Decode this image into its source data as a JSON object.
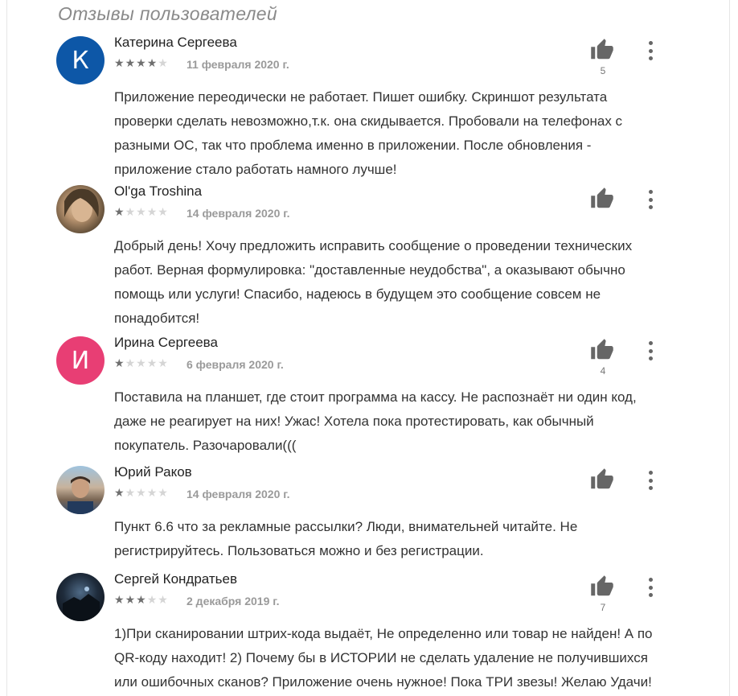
{
  "section": {
    "title": "Отзывы пользователей"
  },
  "colors": {
    "avatar_k": "#0d57a7",
    "avatar_i": "#e83e74"
  },
  "reviews": [
    {
      "author": "Катерина Сергеева",
      "avatar_letter": "К",
      "rating": 4,
      "date": "11 февраля 2020 г.",
      "likes": "5",
      "text": "Приложение переодически не работает. Пишет ошибку. Скриншот результата проверки сделать невозможно,т.к. она скидывается. Пробовали на телефонах с разными ОС, так что проблема именно в приложении. После обновления - приложение стало работать намного лучше!"
    },
    {
      "author": "Ol'ga Troshina",
      "avatar_letter": "",
      "rating": 1,
      "date": "14 февраля 2020 г.",
      "likes": "",
      "text": "Добрый день! Хочу предложить исправить сообщение о проведении технических работ. Верная формулировка: \"доставленные неудобства\", а оказывают обычно помощь или услуги! Спасибо, надеюсь в будущем это сообщение совсем не понадобится!"
    },
    {
      "author": "Ирина Сергеева",
      "avatar_letter": "И",
      "rating": 1,
      "date": "6 февраля 2020 г.",
      "likes": "4",
      "text": "Поставила на планшет, где стоит программа на кассу. Не распознаёт ни один код, даже не реагирует на них! Ужас! Хотела пока протестировать, как обычный покупатель. Разочаровали((("
    },
    {
      "author": "Юрий Раков",
      "avatar_letter": "",
      "rating": 1,
      "date": "14 февраля 2020 г.",
      "likes": "",
      "text": "Пункт 6.6 что за рекламные рассылки? Люди, внимательней читайте. Не регистрируйтесь. Пользоваться можно и без регистрации."
    },
    {
      "author": "Сергей Кондратьев",
      "avatar_letter": "",
      "rating": 3,
      "date": "2 декабря 2019 г.",
      "likes": "7",
      "text": "1)При сканировании штрих-кода выдаёт, Не определенно или товар не найден! А по QR-коду находит! 2) Почему бы в ИСТОРИИ не сделать удаление не получившихся или ошибочных сканов? Приложение очень нужное! Пока ТРИ звезы! Желаю Удачи!"
    }
  ]
}
